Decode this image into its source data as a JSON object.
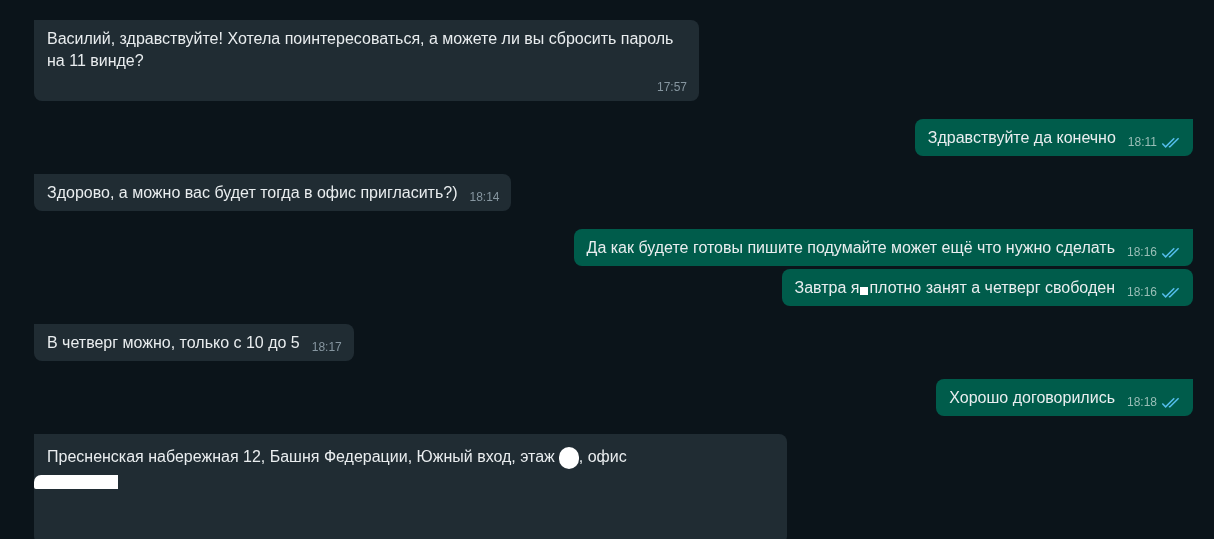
{
  "messages": [
    {
      "outgoing": false,
      "tail": true,
      "parts": [
        {
          "kind": "text",
          "text": "Василий, здравствуйте! Хотела поинтересоваться, а можете ли вы сбросить пароль на 11 винде?"
        }
      ],
      "time": "17:57"
    },
    {
      "outgoing": true,
      "tail": true,
      "parts": [
        {
          "kind": "text",
          "text": "Здравствуйте да конечно"
        }
      ],
      "time": "18:11",
      "read": true
    },
    {
      "outgoing": false,
      "tail": true,
      "parts": [
        {
          "kind": "text",
          "text": "Здорово, а можно вас будет тогда в офис пригласить?)"
        }
      ],
      "time": "18:14"
    },
    {
      "outgoing": true,
      "tail": true,
      "parts": [
        {
          "kind": "text",
          "text": "Да как будете готовы пишите подумайте может ещё что нужно сделать"
        }
      ],
      "time": "18:16",
      "read": true
    },
    {
      "outgoing": true,
      "tail": false,
      "parts": [
        {
          "kind": "text",
          "text": "Завтра я"
        },
        {
          "kind": "redaction"
        },
        {
          "kind": "text",
          "text": "плотно занят а четверг свободен"
        }
      ],
      "time": "18:16",
      "read": true
    },
    {
      "outgoing": false,
      "tail": true,
      "parts": [
        {
          "kind": "text",
          "text": "В четверг можно, только с 10 до 5"
        }
      ],
      "time": "18:17"
    },
    {
      "outgoing": true,
      "tail": true,
      "parts": [
        {
          "kind": "text",
          "text": "Хорошо договорились"
        }
      ],
      "time": "18:18",
      "read": true
    },
    {
      "outgoing": false,
      "tail": true,
      "tall": true,
      "parts": [
        {
          "kind": "text",
          "text": "Пресненская набережная 12, Башня Федерации, Южный вход, этаж"
        },
        {
          "kind": "redaction-blob"
        },
        {
          "kind": "text",
          "text": ", офис"
        },
        {
          "kind": "redaction-bar"
        }
      ]
    }
  ]
}
